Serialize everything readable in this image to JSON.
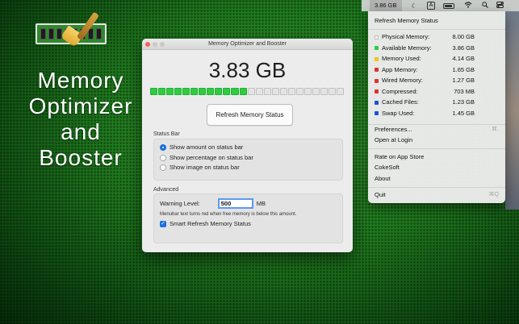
{
  "promo": {
    "lines": [
      "Memory",
      "Optimizer",
      "and",
      "Booster"
    ]
  },
  "window": {
    "title": "Memory Optimizer and Booster",
    "memory_value": "3.83 GB",
    "meter_fraction": 0.48,
    "refresh_label": "Refresh Memory Status",
    "status_bar": {
      "label": "Status Bar",
      "options": [
        "Show amount on status bar",
        "Show percentage on status bar",
        "Show image on status bar"
      ],
      "selected_index": 0
    },
    "advanced": {
      "label": "Advanced",
      "warning_label": "Warning Level:",
      "warning_value": "500",
      "warning_unit": "MB",
      "hint": "Menubar text turns red when free memory is below this amount.",
      "smart_refresh_label": "Smart Refresh Memory Status",
      "smart_refresh_checked": true
    }
  },
  "menubar": {
    "memory": "3.86 GB",
    "icons": [
      "moon-icon",
      "input-source-icon",
      "battery-icon",
      "wifi-icon",
      "spotlight-icon",
      "control-center-icon"
    ],
    "input_source": "A"
  },
  "menu": {
    "refresh": "Refresh Memory Status",
    "stats": [
      {
        "label": "Physical Memory:",
        "value": "8.00 GB",
        "color": "#ffffff"
      },
      {
        "label": "Available Memory:",
        "value": "3.86 GB",
        "color": "#2ecc40"
      },
      {
        "label": "Memory Used:",
        "value": "4.14 GB",
        "color": "#f1c40f"
      },
      {
        "label": "App Memory:",
        "value": "1.65 GB",
        "color": "#e03131"
      },
      {
        "label": "Wired Memory:",
        "value": "1.27 GB",
        "color": "#e03131"
      },
      {
        "label": "Compressed:",
        "value": "703 MB",
        "color": "#e03131"
      },
      {
        "label": "Cached Files:",
        "value": "1.23 GB",
        "color": "#1b4fe0"
      },
      {
        "label": "Swap Used:",
        "value": "1.45 GB",
        "color": "#1b4fe0"
      }
    ],
    "preferences": "Preferences...",
    "preferences_shortcut": "⌘,",
    "open_at_login": "Open at Login",
    "rate": "Rate on App Store",
    "cokesoft": "CokeSoft",
    "about": "About",
    "quit": "Quit",
    "quit_shortcut": "⌘Q"
  }
}
